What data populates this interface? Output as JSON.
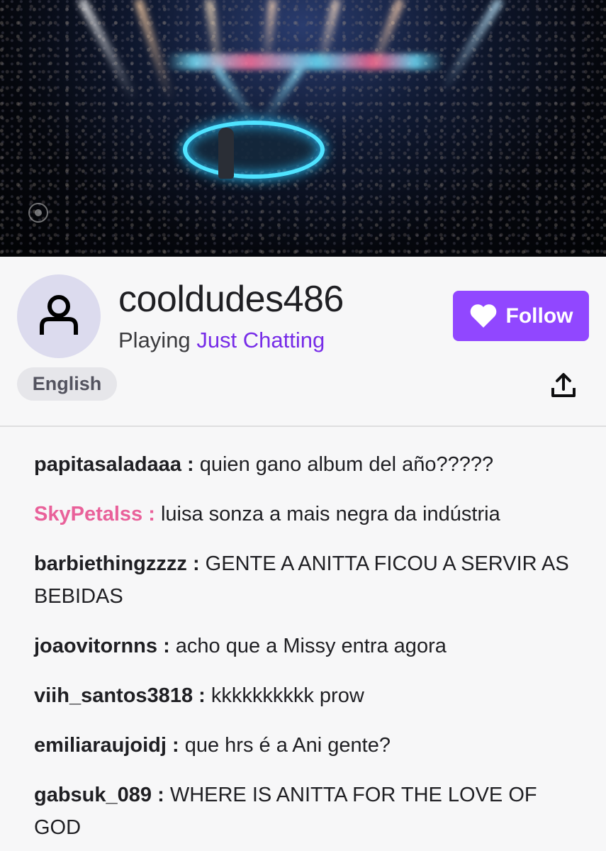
{
  "video": {
    "network_logo": "cbs-eye-icon"
  },
  "channel": {
    "name": "cooldudes486",
    "playing_prefix": "Playing",
    "category": "Just Chatting",
    "language": "English",
    "avatar_icon": "user-silhouette-icon"
  },
  "actions": {
    "follow_label": "Follow",
    "follow_icon": "heart-icon",
    "share_icon": "share-upload-icon"
  },
  "colors": {
    "accent": "#9147ff",
    "category_link": "#772ce8",
    "highlight_user": "#e9619a"
  },
  "chat": {
    "messages": [
      {
        "user": "papitasaladaaa",
        "text": "quien gano album del año?????"
      },
      {
        "user": "SkyPetalss",
        "text": "luisa sonza a mais negra da indústria",
        "color": "#e9619a"
      },
      {
        "user": "barbiethingzzzz",
        "text": "GENTE A ANITTA FICOU A SERVIR AS BEBIDAS"
      },
      {
        "user": "joaovitornns",
        "text": "acho que a Missy entra agora"
      },
      {
        "user": "viih_santos3818",
        "text": "kkkkkkkkkk prow"
      },
      {
        "user": "emiliaraujoidj",
        "text": "que hrs é a Ani gente?"
      },
      {
        "user": "gabsuk_089",
        "text": "WHERE IS ANITTA FOR THE LOVE OF GOD"
      }
    ]
  }
}
